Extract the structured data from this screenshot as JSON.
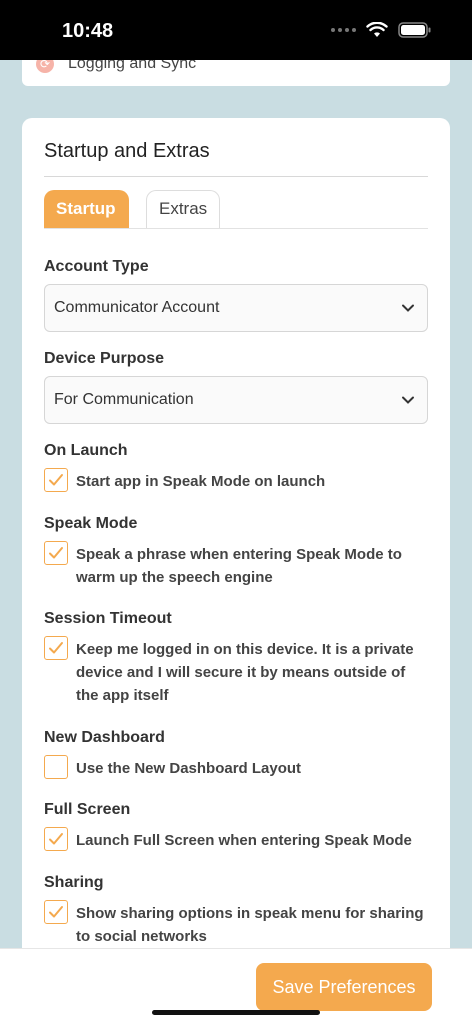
{
  "status": {
    "time": "10:48"
  },
  "top_card": {
    "label": "Logging and Sync",
    "icon": "sync-icon"
  },
  "card": {
    "title": "Startup and Extras"
  },
  "tabs": [
    {
      "label": "Startup",
      "active": true
    },
    {
      "label": "Extras",
      "active": false
    }
  ],
  "account_type": {
    "label": "Account Type",
    "value": "Communicator Account"
  },
  "device_purpose": {
    "label": "Device Purpose",
    "value": "For Communication"
  },
  "sections": [
    {
      "label": "On Launch",
      "checked": true,
      "text": "Start app in Speak Mode on launch"
    },
    {
      "label": "Speak Mode",
      "checked": true,
      "text": "Speak a phrase when entering Speak Mode to warm up the speech engine"
    },
    {
      "label": "Session Timeout",
      "checked": true,
      "text": "Keep me logged in on this device. It is a private device and I will secure it by means outside of the app itself"
    },
    {
      "label": "New Dashboard",
      "checked": false,
      "text": "Use the New Dashboard Layout"
    },
    {
      "label": "Full Screen",
      "checked": true,
      "text": "Launch Full Screen when entering Speak Mode"
    },
    {
      "label": "Sharing",
      "checked": true,
      "text": "Show sharing options in speak menu for sharing to social networks"
    }
  ],
  "save_button": {
    "label": "Save Preferences"
  },
  "colors": {
    "accent": "#f4a94e",
    "background": "#c9dde2"
  }
}
